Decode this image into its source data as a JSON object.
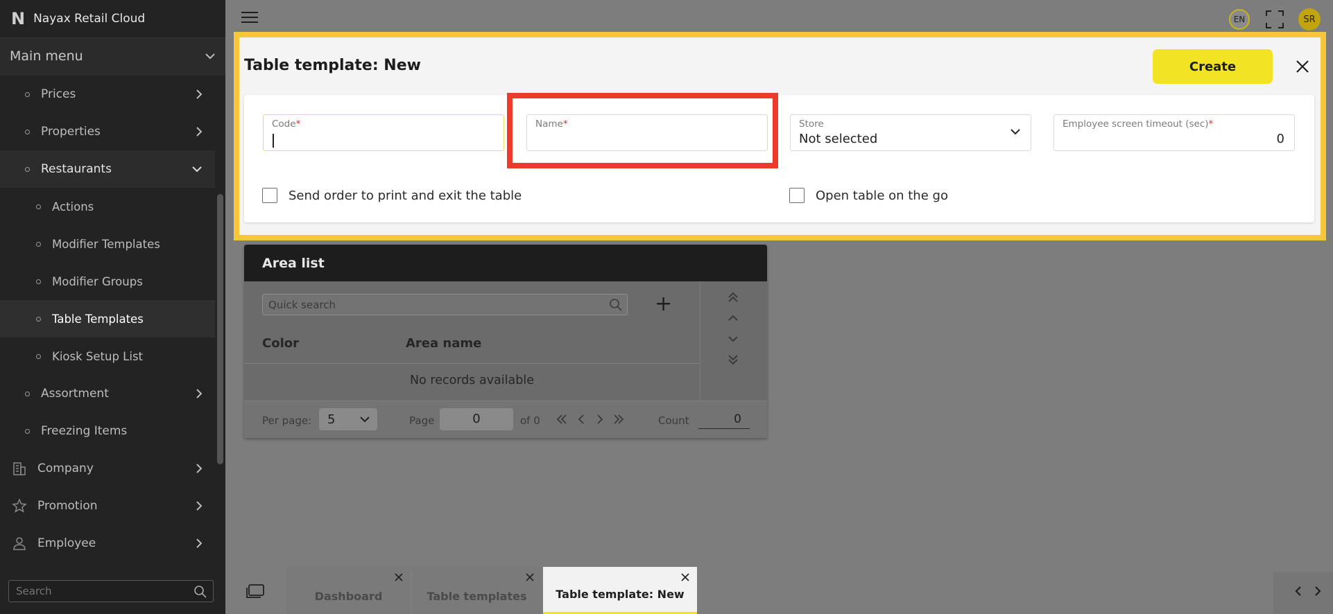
{
  "app": {
    "brand": "Nayax Retail Cloud",
    "brand_logo": "N"
  },
  "sidebar": {
    "main_menu_label": "Main menu",
    "items": [
      {
        "label": "Prices",
        "level": 1,
        "chevron": "right"
      },
      {
        "label": "Properties",
        "level": 1,
        "chevron": "right"
      },
      {
        "label": "Restaurants",
        "level": 1,
        "chevron": "down"
      },
      {
        "label": "Actions",
        "level": 2
      },
      {
        "label": "Modifier Templates",
        "level": 2
      },
      {
        "label": "Modifier Groups",
        "level": 2
      },
      {
        "label": "Table Templates",
        "level": 2
      },
      {
        "label": "Kiosk Setup List",
        "level": 2
      },
      {
        "label": "Assortment",
        "level": 1,
        "chevron": "right"
      },
      {
        "label": "Freezing Items",
        "level": 1
      },
      {
        "label": "Company",
        "level": 0,
        "icon": "building-icon",
        "chevron": "right"
      },
      {
        "label": "Promotion",
        "level": 0,
        "icon": "star-icon",
        "chevron": "right"
      },
      {
        "label": "Employee",
        "level": 0,
        "icon": "person-icon",
        "chevron": "right"
      }
    ],
    "search_placeholder": "Search"
  },
  "topbar": {
    "language": "EN",
    "avatar_initials": "SR"
  },
  "dialog": {
    "title": "Table template: New",
    "create_label": "Create",
    "fields": {
      "code": {
        "label": "Code",
        "value": ""
      },
      "name": {
        "label": "Name",
        "value": ""
      },
      "store": {
        "label": "Store",
        "value": "Not selected"
      },
      "timeout": {
        "label": "Employee screen timeout (sec)",
        "value": "0"
      }
    },
    "required_mark": "*",
    "checkboxes": {
      "send_order": {
        "label": "Send order to print and exit the table",
        "checked": false
      },
      "open_on_go": {
        "label": "Open table on the go",
        "checked": false
      }
    }
  },
  "area_list": {
    "title": "Area list",
    "search_placeholder": "Quick search",
    "columns": [
      "Color",
      "Area name"
    ],
    "empty_text": "No records available",
    "footer": {
      "per_page_label": "Per page:",
      "per_page_value": "5",
      "page_label": "Page",
      "page_value": "0",
      "of_label": "of 0",
      "count_label": "Count",
      "count_value": "0"
    }
  },
  "tabs": [
    {
      "label": "Dashboard",
      "active": false
    },
    {
      "label": "Table templates",
      "active": false
    },
    {
      "label": "Table template: New",
      "active": true
    }
  ],
  "colors": {
    "accent": "#f2e424",
    "highlight_frame": "#f6c73a",
    "red_box": "#ee3a2d",
    "sidebar_bg": "#232323"
  }
}
